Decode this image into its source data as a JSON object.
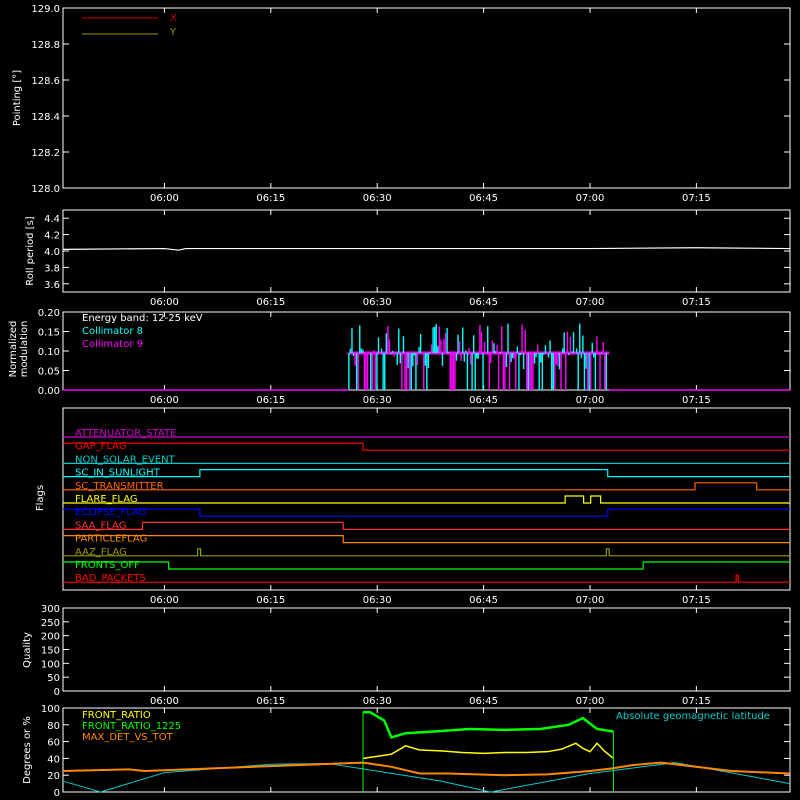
{
  "time_axis": {
    "tick_labels": [
      "06:00",
      "06:15",
      "06:30",
      "06:45",
      "07:00",
      "07:15"
    ],
    "tick_minutes": [
      360,
      375,
      390,
      405,
      420,
      435
    ],
    "start_minute": 345.7,
    "end_minute": 448.2
  },
  "colors": {
    "background": "#000000",
    "axis": "#ffffff",
    "x_series": "#cc0000",
    "y_series": "#999900",
    "collimator8": "#00ffff",
    "collimator9": "#ff00ff",
    "front_ratio": "#ffff00",
    "front_ratio_1225": "#00ff00",
    "max_det": "#ff8800",
    "geomag": "#00cccc"
  },
  "chart_data": [
    {
      "type": "line",
      "panel": "pointing",
      "ylabel": "Pointing [°]",
      "ylim": [
        128.0,
        129.0
      ],
      "yticks": [
        "128.0",
        "128.2",
        "128.4",
        "128.6",
        "128.8",
        "129.0"
      ],
      "legend": [
        "X",
        "Y"
      ],
      "legend_placement": "top-left",
      "series": [
        {
          "name": "X",
          "values": []
        },
        {
          "name": "Y",
          "values": []
        }
      ]
    },
    {
      "type": "line",
      "panel": "roll",
      "ylabel": "Roll period [s]",
      "ylim": [
        3.5,
        4.5
      ],
      "yticks": [
        "3.6",
        "3.8",
        "4.0",
        "4.2",
        "4.4"
      ],
      "series": [
        {
          "x": [
            345.7,
            360,
            362,
            363,
            375,
            390,
            420,
            435,
            448.2
          ],
          "values": [
            4.02,
            4.03,
            4.01,
            4.03,
            4.03,
            4.03,
            4.03,
            4.04,
            4.03
          ]
        }
      ]
    },
    {
      "type": "bar",
      "panel": "modulation",
      "ylabel": "Normalized modulation",
      "ylim": [
        0.0,
        0.2
      ],
      "yticks": [
        "0.00",
        "0.05",
        "0.10",
        "0.15",
        "0.20"
      ],
      "annotation": "Energy band: 12-25 keV",
      "legend": [
        "Collimator 8",
        "Collimator 9"
      ],
      "legend_placement": "top-left",
      "active_range": [
        386.0,
        422.7
      ],
      "baseline_value": 0.095
    },
    {
      "type": "line",
      "panel": "flags",
      "ylabel": "Flags",
      "flags": [
        {
          "name": "ATTENUATOR_STATE",
          "color": "#cc00cc",
          "segments": [
            [
              345.7,
              448.2,
              0
            ]
          ]
        },
        {
          "name": "GAP_FLAG",
          "color": "#ff0000",
          "segments": [
            [
              345.7,
              388.0,
              1
            ],
            [
              388.0,
              448.2,
              0
            ]
          ]
        },
        {
          "name": "NON_SOLAR_EVENT",
          "color": "#00cccc",
          "segments": [
            [
              345.7,
              448.2,
              0
            ]
          ]
        },
        {
          "name": "SC_IN_SUNLIGHT",
          "color": "#00ffff",
          "segments": [
            [
              345.7,
              365.0,
              0
            ],
            [
              365.0,
              422.5,
              1
            ],
            [
              422.5,
              448.2,
              0
            ]
          ]
        },
        {
          "name": "SC_TRANSMITTER",
          "color": "#ff6600",
          "segments": [
            [
              345.7,
              434.8,
              0
            ],
            [
              434.8,
              443.5,
              1
            ],
            [
              443.5,
              448.2,
              0
            ]
          ]
        },
        {
          "name": "FLARE_FLAG",
          "color": "#ffff00",
          "segments": [
            [
              345.7,
              416.5,
              0
            ],
            [
              416.5,
              419.1,
              1
            ],
            [
              419.1,
              420.1,
              0
            ],
            [
              420.1,
              421.5,
              1
            ],
            [
              421.5,
              448.2,
              0
            ]
          ]
        },
        {
          "name": "ECLIPSE_FLAG",
          "color": "#0000ff",
          "segments": [
            [
              345.7,
              365.0,
              1
            ],
            [
              365.0,
              422.5,
              0
            ],
            [
              422.5,
              448.2,
              1
            ]
          ]
        },
        {
          "name": "SAA_FLAG",
          "color": "#ff3333",
          "segments": [
            [
              345.7,
              356.9,
              0
            ],
            [
              356.9,
              385.2,
              1
            ],
            [
              385.2,
              448.2,
              0
            ]
          ]
        },
        {
          "name": "PARTICLEFLAG",
          "color": "#ff8800",
          "segments": [
            [
              345.7,
              385.2,
              1
            ],
            [
              385.2,
              448.2,
              0
            ]
          ]
        },
        {
          "name": "AAZ_FLAG",
          "color": "#999900",
          "segments": [
            [
              345.7,
              364.7,
              0
            ],
            [
              364.7,
              365.1,
              1
            ],
            [
              365.1,
              422.3,
              0
            ],
            [
              422.3,
              422.7,
              1
            ],
            [
              422.7,
              448.2,
              0
            ]
          ]
        },
        {
          "name": "FRONTS_OFF",
          "color": "#00ff00",
          "segments": [
            [
              345.7,
              360.6,
              1
            ],
            [
              360.6,
              427.5,
              0
            ],
            [
              427.5,
              448.2,
              1
            ]
          ]
        },
        {
          "name": "BAD_PACKETS",
          "color": "#ff0000",
          "segments": [
            [
              345.7,
              440.6,
              0
            ],
            [
              440.6,
              440.9,
              1
            ],
            [
              440.9,
              448.2,
              0
            ]
          ]
        }
      ]
    },
    {
      "type": "line",
      "panel": "quality",
      "ylabel": "Quality",
      "ylim": [
        0,
        300
      ],
      "yticks": [
        "0",
        "50",
        "100",
        "150",
        "200",
        "250",
        "300"
      ],
      "series": []
    },
    {
      "type": "line",
      "panel": "ratios",
      "ylabel": "Degrees or %",
      "ylim": [
        0,
        100
      ],
      "yticks": [
        "0",
        "20",
        "40",
        "60",
        "80",
        "100"
      ],
      "legend_placement": "top-left",
      "annotation": "Absolute geomagnetic latitude",
      "series": [
        {
          "name": "FRONT_RATIO",
          "x": [
            388,
            392,
            394,
            396,
            399,
            402,
            405,
            408,
            411,
            414,
            416,
            418,
            419,
            420,
            421,
            422,
            423.3
          ],
          "values": [
            40,
            45,
            55,
            50,
            49,
            47,
            46,
            47,
            47,
            48,
            51,
            58,
            52,
            48,
            58,
            49,
            40
          ]
        },
        {
          "name": "FRONT_RATIO_1225",
          "x": [
            388,
            389,
            391,
            392,
            394,
            398,
            403,
            408,
            413,
            417,
            419,
            421,
            423.3
          ],
          "values": [
            95,
            95,
            85,
            65,
            70,
            72,
            75,
            74,
            75,
            80,
            88,
            75,
            72
          ]
        },
        {
          "name": "MAX_DET_VS_TOT",
          "x": [
            345.7,
            355,
            357.2,
            388,
            392,
            396,
            400,
            408,
            414,
            420,
            423,
            426,
            430,
            440,
            448.2
          ],
          "values": [
            25,
            27,
            25,
            35,
            30,
            22,
            22,
            20,
            21,
            25,
            28,
            32,
            35,
            25,
            22
          ]
        },
        {
          "name": "Absolute geomagnetic latitude",
          "x": [
            345.7,
            351.0,
            360.0,
            375.0,
            383.0,
            399.0,
            406.0,
            420.0,
            432.0,
            448.2
          ],
          "values": [
            13,
            0,
            23,
            33,
            34,
            13,
            0,
            22,
            35,
            10
          ]
        }
      ]
    }
  ]
}
